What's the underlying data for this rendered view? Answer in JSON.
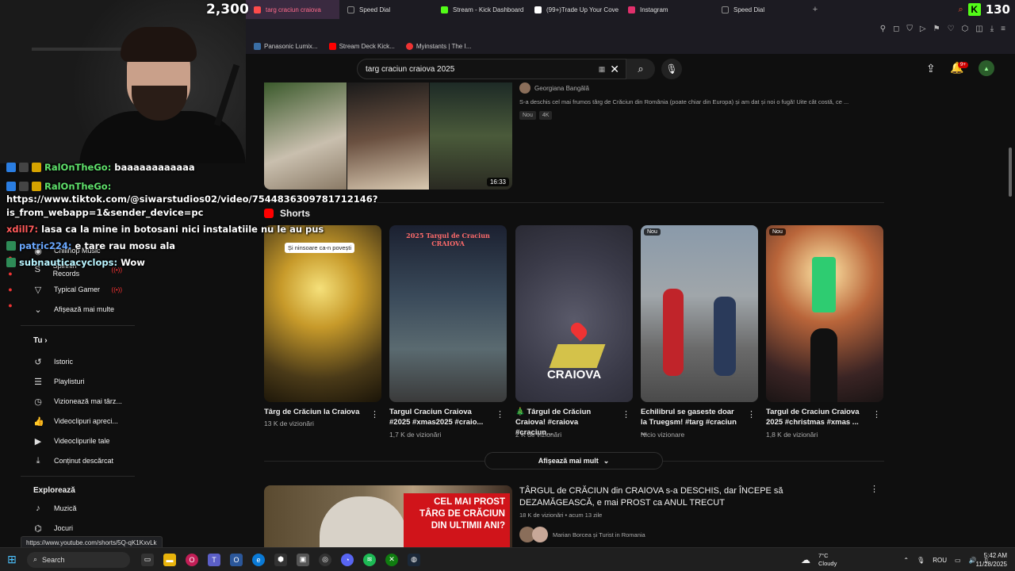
{
  "stream": {
    "viewer_count": "2,300",
    "kick_follow_count": "130"
  },
  "browser": {
    "tabs": [
      {
        "label": "targ craciun craiova",
        "active": true,
        "color": "#ff4b4b"
      },
      {
        "label": "Speed Dial",
        "active": false,
        "color": "#888888"
      },
      {
        "label": "Stream - Kick Dashboard",
        "active": false,
        "color": "#53fc18"
      },
      {
        "label": "(99+)Trade Up Your Cove",
        "active": false,
        "color": "#ffffff"
      },
      {
        "label": "Instagram",
        "active": false,
        "color": "#e1306c"
      },
      {
        "label": "Speed Dial",
        "active": false,
        "color": "#888888"
      }
    ],
    "new_tab_label": "+",
    "bookmarks": [
      {
        "label": "Panasonic Lumix...",
        "color": "#3a6ea5"
      },
      {
        "label": "Stream Deck Kick...",
        "color": "#ff0000"
      },
      {
        "label": "Myinstants | The I...",
        "color": "#e33"
      }
    ]
  },
  "youtube": {
    "search_value": "targ craciun craiova 2025",
    "notif_badge": "9+",
    "top_video": {
      "channel": "Georgiana Bangălă",
      "description": "S-a deschis cel mai frumos târg de Crăciun din România (poate chiar din Europa) și am dat și noi o fugă! Uite cât costă, ce ...",
      "tags": [
        "Nou",
        "4K"
      ],
      "duration": "16:33"
    },
    "shorts_title": "Shorts",
    "shorts": [
      {
        "title": "Târg de Crăciun la Craiova",
        "views": "13 K de vizionări",
        "badge": "",
        "overlay": "Și ninsoare ca-n povești"
      },
      {
        "title": "Targul Craciun Craiova #2025 #xmas2025 #craio...",
        "views": "1,7 K de vizionări",
        "badge": "",
        "overlay": "2025 Targul de Craciun CRAIOVA"
      },
      {
        "title": "🎄 Târgul de Crăciun Craiova! #craiova #craciun...",
        "views": "2 K de vizionări",
        "badge": "",
        "overlay": "CRAIOVA"
      },
      {
        "title": "Echilibrul se gaseste doar la Truegsm! #targ #craciun ...",
        "views": "Nicio vizionare",
        "badge": "Nou",
        "overlay": ""
      },
      {
        "title": "Targul de Craciun Craiova 2025 #christmas #xmas ...",
        "views": "1,8 K de vizionări",
        "badge": "Nou",
        "overlay": ""
      }
    ],
    "show_more_label": "Afișează mai mult",
    "second_video": {
      "title": "TÂRGUL de CRĂCIUN din CRAIOVA s-a DESCHIS, dar ÎNCEPE să DEZAMĂGEASCĂ, e mai PROST ca ANUL TRECUT",
      "meta": "18 K de vizionări • acum 13 zile",
      "channel": "Marian Borcea și Turist in Romania",
      "thumb_text": "CEL MAI PROST TÂRG DE CRĂCIUN DIN ULTIMII ANI?"
    },
    "sidebar": {
      "subs": [
        {
          "label": "Chillhop Music",
          "live": false
        },
        {
          "label": "Spinnin' Records",
          "live": true
        },
        {
          "label": "Typical Gamer",
          "live": true
        }
      ],
      "show_more": "Afișează mai multe",
      "you_heading": "Tu",
      "you_items": [
        {
          "label": "Istoric"
        },
        {
          "label": "Playlisturi"
        },
        {
          "label": "Vizionează mai târz..."
        },
        {
          "label": "Videoclipuri apreci..."
        },
        {
          "label": "Videoclipurile tale"
        },
        {
          "label": "Conținut descărcat"
        }
      ],
      "explore_heading": "Explorează",
      "explore_items": [
        {
          "label": "Muzică"
        },
        {
          "label": "Jocuri"
        }
      ]
    },
    "status_url": "https://www.youtube.com/shorts/5Q-qK1KxvLk"
  },
  "chat": [
    {
      "user": "RalOnTheGo:",
      "msg": "baaaaaaaaaaaa",
      "color": "green"
    },
    {
      "user": "RalOnTheGo:",
      "msg": "",
      "color": "green"
    },
    {
      "user": "",
      "msg": "https://www.tiktok.com/@siwarstudios02/video/7544836309781712146?",
      "color": ""
    },
    {
      "user": "",
      "msg": "is_from_webapp=1&sender_device=pc",
      "color": ""
    },
    {
      "user": "xdill7:",
      "msg": "lasa ca la mine in botosani nici instalatiile nu le au pus",
      "color": "red"
    },
    {
      "user": "patric224:",
      "msg": "e tare rau mosu ala",
      "color": "blue"
    },
    {
      "user": "subnauticacyclops:",
      "msg": "Wow",
      "color": "teal"
    }
  ],
  "taskbar": {
    "search_label": "Search",
    "weather_temp": "7°C",
    "weather_desc": "Cloudy",
    "lang": "ROU",
    "time": "5:42 AM",
    "date": "11/28/2025"
  }
}
